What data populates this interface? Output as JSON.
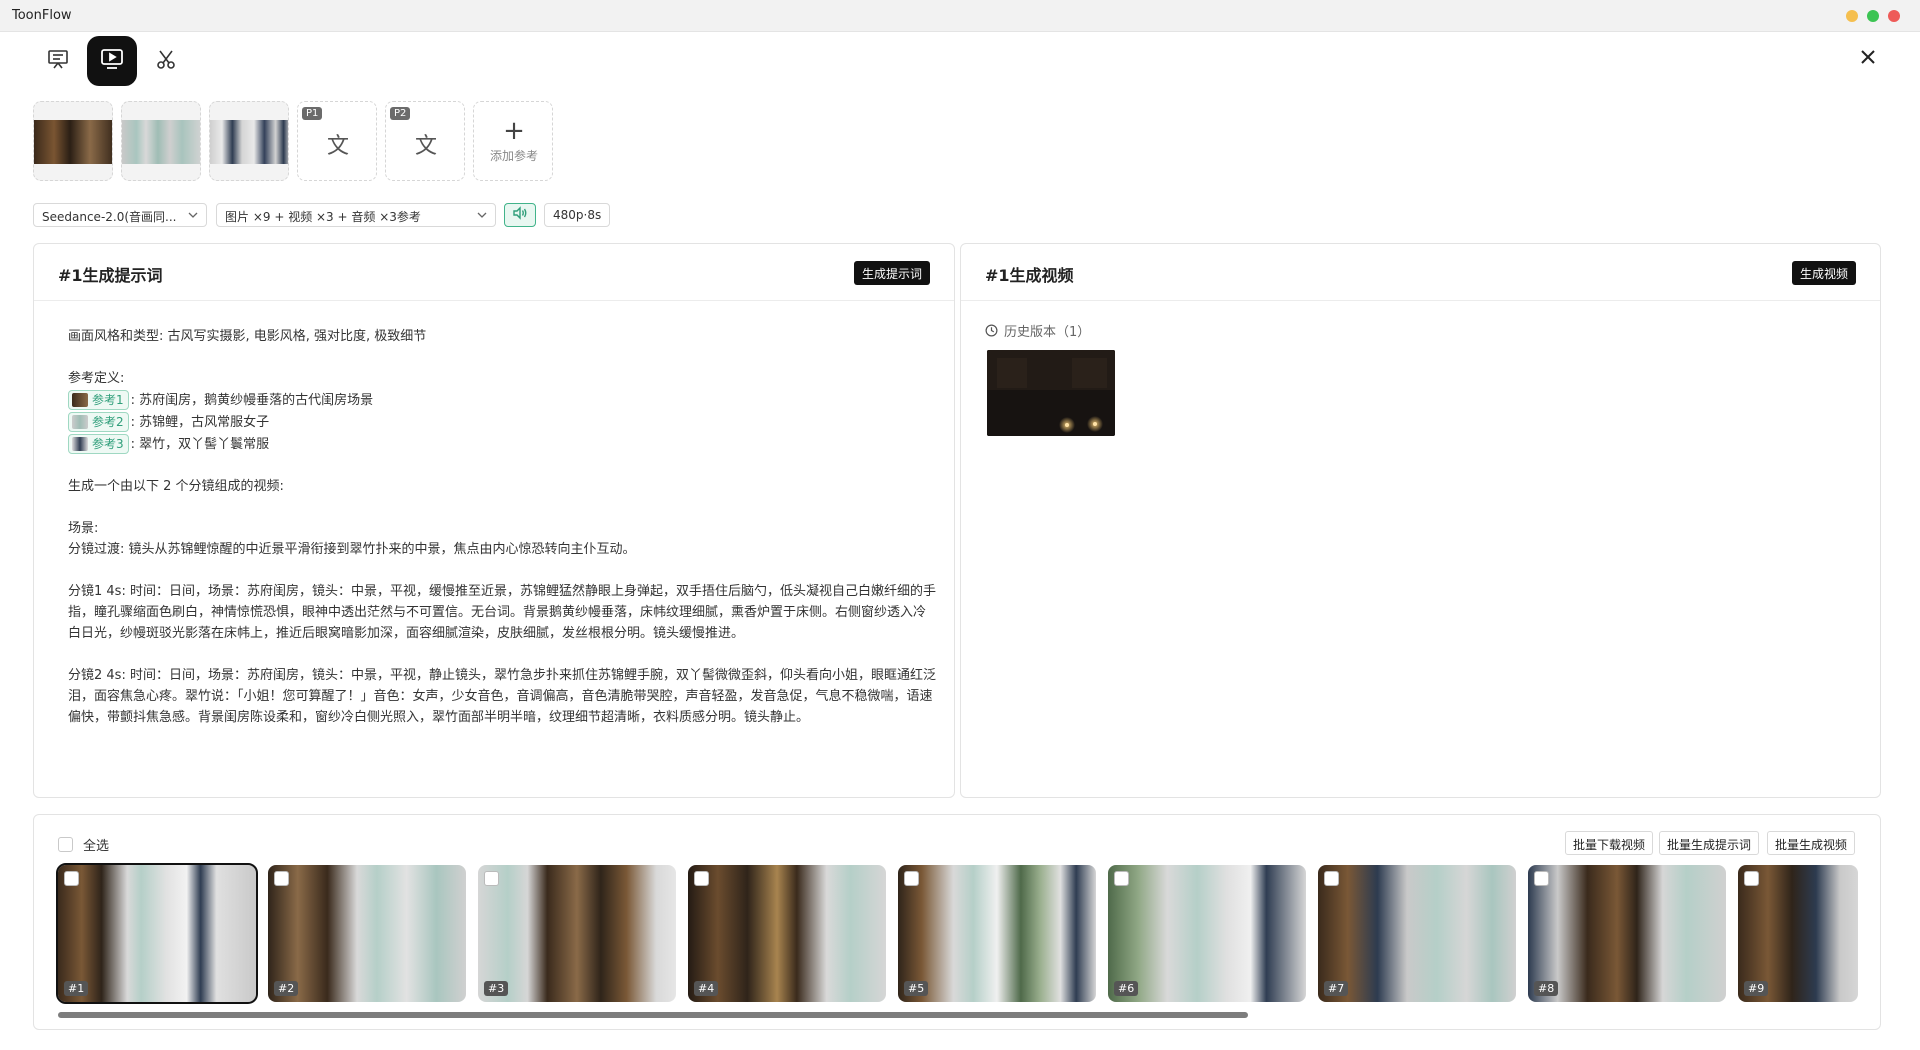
{
  "window": {
    "title": "ToonFlow"
  },
  "references": [
    {
      "type": "image",
      "label": ""
    },
    {
      "type": "image",
      "label": ""
    },
    {
      "type": "image",
      "label": ""
    },
    {
      "type": "text",
      "badge": "P1",
      "glyph": "文"
    },
    {
      "type": "text",
      "badge": "P2",
      "glyph": "文"
    },
    {
      "type": "add",
      "label": "添加参考"
    }
  ],
  "controls": {
    "model": "Seedance-2.0(音画同...",
    "inputs": "图片 ×9 + 视频 ×3 + 音频 ×3参考",
    "resolution": "480p·8s"
  },
  "prompt_panel": {
    "title": "#1生成提示词",
    "button": "生成提示词",
    "style": "画面风格和类型: 古风写实摄影, 电影风格, 强对比度, 极致细节",
    "ref_heading": "参考定义:",
    "refs": [
      {
        "chip": "参考1",
        "desc": ": 苏府闺房，鹅黄纱幔垂落的古代闺房场景"
      },
      {
        "chip": "参考2",
        "desc": ": 苏锦鲤，古风常服女子"
      },
      {
        "chip": "参考3",
        "desc": ": 翠竹，双丫髻丫鬟常服"
      }
    ],
    "intro": "生成一个由以下 2 个分镜组成的视频:",
    "scene_heading": "场景:",
    "transition": "分镜过渡: 镜头从苏锦鲤惊醒的中近景平滑衔接到翠竹扑来的中景，焦点由内心惊恐转向主仆互动。",
    "shot1": "分镜1 4s: 时间：日间，场景：苏府闺房，镜头：中景，平视，缓慢推至近景，苏锦鲤猛然静眼上身弹起，双手捂住后脑勺，低头凝视自己白嫩纤细的手指，瞳孔骤缩面色刷白，神情惊慌恐惧，眼神中透出茫然与不可置信。无台词。背景鹅黄纱幔垂落，床帏纹理细腻，熏香炉置于床侧。右侧窗纱透入冷白日光，纱幔斑驳光影落在床帏上，推近后眼窝暗影加深，面容细腻渲染，皮肤细腻，发丝根根分明。镜头缓慢推进。",
    "shot2": "分镜2 4s: 时间：日间，场景：苏府闺房，镜头：中景，平视，静止镜头，翠竹急步扑来抓住苏锦鲤手腕，双丫髻微微歪斜，仰头看向小姐，眼眶通红泛泪，面容焦急心疼。翠竹说：「小姐！您可算醒了！」音色：女声，少女音色，音调偏高，音色清脆带哭腔，声音轻盈，发音急促，气息不稳微喘，语速偏快，带颤抖焦急感。背景闺房陈设柔和，窗纱冷白侧光照入，翠竹面部半明半暗，纹理细节超清晰，衣料质感分明。镜头静止。"
  },
  "video_panel": {
    "title": "#1生成视频",
    "button": "生成视频",
    "history_label": "历史版本（1）"
  },
  "storyboard": {
    "select_all": "全选",
    "batch_download": "批量下载视频",
    "batch_prompt": "批量生成提示词",
    "batch_video": "批量生成视频",
    "shots": [
      "#1",
      "#2",
      "#3",
      "#4",
      "#5",
      "#6",
      "#7",
      "#8",
      "#9"
    ]
  },
  "colors": {
    "accent": "#41b38a",
    "chip_text": "#2f9e7a",
    "dark": "#111111"
  },
  "icons": {
    "tool1": "presentation-icon",
    "tool2": "monitor-play-icon",
    "tool3": "scissors-icon",
    "close": "close-icon",
    "audio": "speaker-icon",
    "history": "clock-icon"
  }
}
